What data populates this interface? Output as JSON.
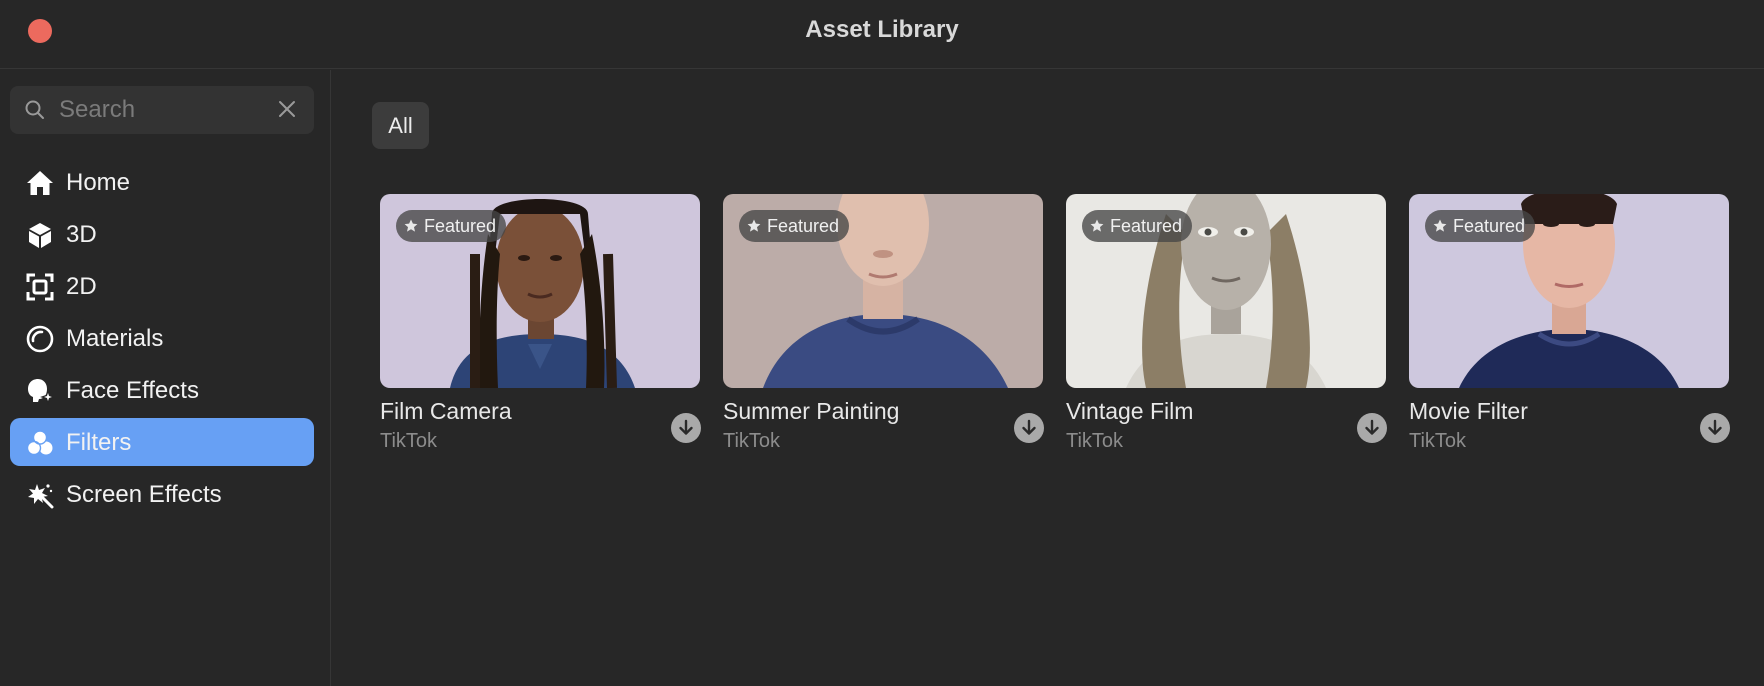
{
  "window": {
    "title": "Asset Library"
  },
  "search": {
    "placeholder": "Search",
    "value": ""
  },
  "sidebar": {
    "items": [
      {
        "label": "Home",
        "icon": "home-icon",
        "active": false
      },
      {
        "label": "3D",
        "icon": "cube-icon",
        "active": false
      },
      {
        "label": "2D",
        "icon": "frame-icon",
        "active": false
      },
      {
        "label": "Materials",
        "icon": "materials-icon",
        "active": false
      },
      {
        "label": "Face Effects",
        "icon": "face-effects-icon",
        "active": false
      },
      {
        "label": "Filters",
        "icon": "filters-icon",
        "active": true
      },
      {
        "label": "Screen Effects",
        "icon": "screen-effects-icon",
        "active": false
      }
    ]
  },
  "filter": {
    "label": "All"
  },
  "assets": [
    {
      "title": "Film Camera",
      "author": "TikTok",
      "badge": "Featured"
    },
    {
      "title": "Summer Painting",
      "author": "TikTok",
      "badge": "Featured"
    },
    {
      "title": "Vintage Film",
      "author": "TikTok",
      "badge": "Featured"
    },
    {
      "title": "Movie Filter",
      "author": "TikTok",
      "badge": "Featured"
    }
  ],
  "colors": {
    "accent": "#67a0f4",
    "close": "#ec6a5e",
    "background": "#272727"
  }
}
